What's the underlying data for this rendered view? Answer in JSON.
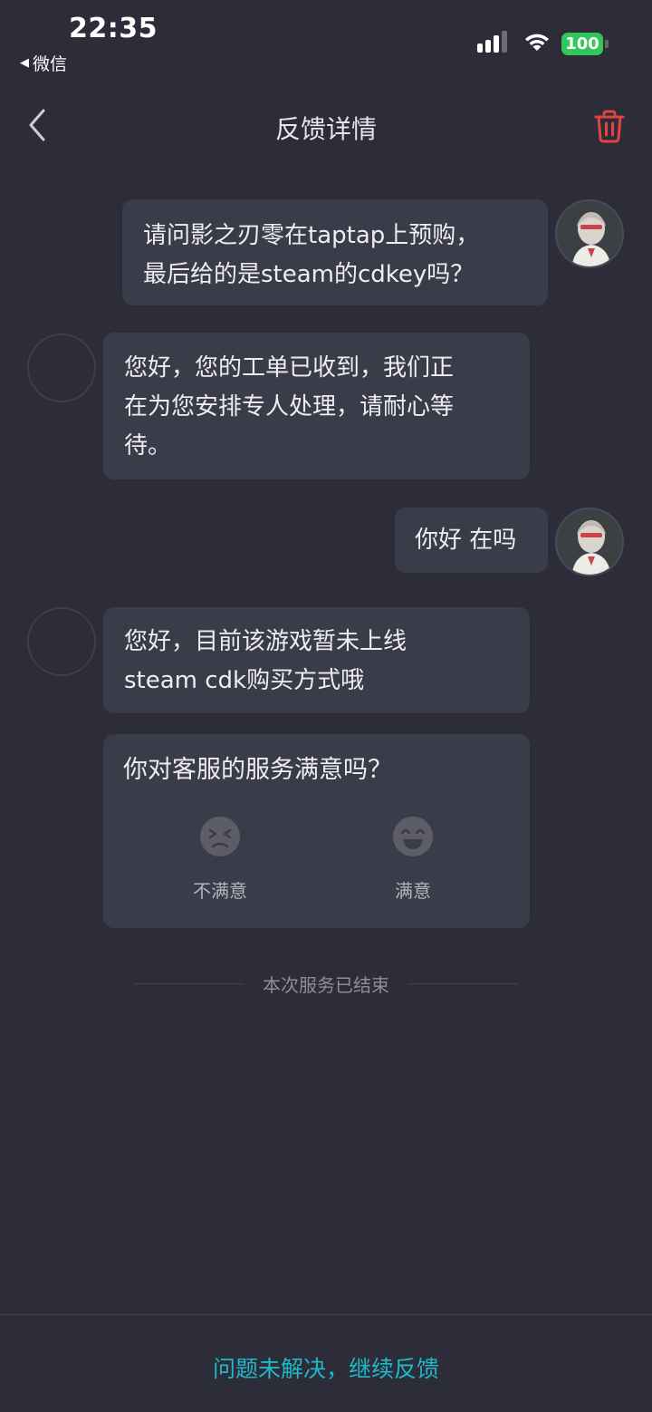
{
  "status_bar": {
    "time": "22:35",
    "back_app": "微信",
    "battery": "100",
    "icons": [
      "signal-icon",
      "wifi-icon",
      "battery-icon"
    ]
  },
  "nav": {
    "title": "反馈详情",
    "icons": [
      "back-chevron-icon",
      "trash-icon"
    ],
    "trash_color": "#e2443f"
  },
  "messages": [
    {
      "from": "user",
      "lines": [
        "请问影之刃零在taptap上预购，",
        "最后给的是steam的cdkey吗？"
      ]
    },
    {
      "from": "agent",
      "lines": [
        "您好，您的工单已收到，我们正",
        "在为您安排专人处理，请耐心等",
        "待。"
      ]
    },
    {
      "from": "user",
      "lines": [
        "你好 在吗"
      ]
    },
    {
      "from": "agent",
      "lines": [
        "您好，目前该游戏暂未上线",
        "steam cdk购买方式哦"
      ]
    }
  ],
  "survey": {
    "question": "你对客服的服务满意吗？",
    "options": [
      {
        "label": "不满意",
        "icon": "unsatisfied-face-icon"
      },
      {
        "label": "满意",
        "icon": "satisfied-face-icon"
      }
    ]
  },
  "ended_text": "本次服务已结束",
  "bottom_action": "问题未解决，继续反馈",
  "colors": {
    "background": "#2c2d39",
    "bubble": "#3b3c49",
    "accent": "#20b8c8",
    "battery": "#32c759"
  }
}
